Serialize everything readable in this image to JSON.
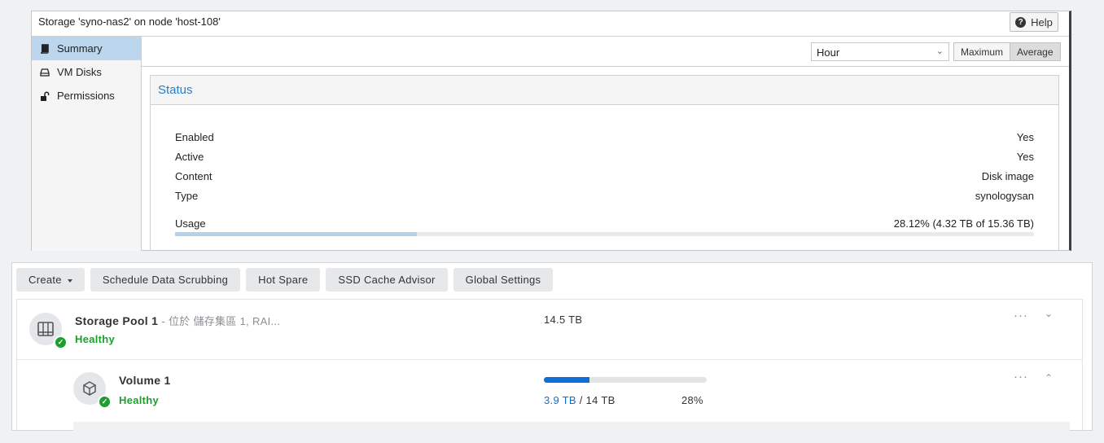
{
  "pve": {
    "title": "Storage 'syno-nas2' on node 'host-108'",
    "help_label": "Help",
    "nav": [
      {
        "label": "Summary",
        "icon": "book-icon",
        "selected": true
      },
      {
        "label": "VM Disks",
        "icon": "hdd-icon",
        "selected": false
      },
      {
        "label": "Permissions",
        "icon": "unlock-icon",
        "selected": false
      }
    ],
    "timeframe": {
      "value": "Hour"
    },
    "consolidation": {
      "maximum": "Maximum",
      "average": "Average",
      "active": "Average"
    },
    "status": {
      "heading": "Status",
      "rows": [
        {
          "label": "Enabled",
          "value": "Yes"
        },
        {
          "label": "Active",
          "value": "Yes"
        },
        {
          "label": "Content",
          "value": "Disk image"
        },
        {
          "label": "Type",
          "value": "synologysan"
        }
      ],
      "usage": {
        "label": "Usage",
        "value": "28.12% (4.32 TB of 15.36 TB)",
        "fraction": 0.2812
      }
    }
  },
  "syno": {
    "toolbar": {
      "create": "Create",
      "scrub": "Schedule Data Scrubbing",
      "hot_spare": "Hot Spare",
      "ssd_cache": "SSD Cache Advisor",
      "global": "Global Settings"
    },
    "pool": {
      "name": "Storage Pool 1",
      "subtitle": "- 位於 儲存集區 1, RAI...",
      "status": "Healthy",
      "size": "14.5 TB",
      "more": "···",
      "chevron": "⌄"
    },
    "volume": {
      "name": "Volume 1",
      "status": "Healthy",
      "used": "3.9 TB",
      "total": "/ 14 TB",
      "percent": "28%",
      "fraction": 0.28,
      "more": "···",
      "chevron": "⌃"
    },
    "colors": {
      "healthy": "#1e9e2f",
      "accent": "#0b6fd6",
      "used_text": "#0b6fd6"
    }
  }
}
